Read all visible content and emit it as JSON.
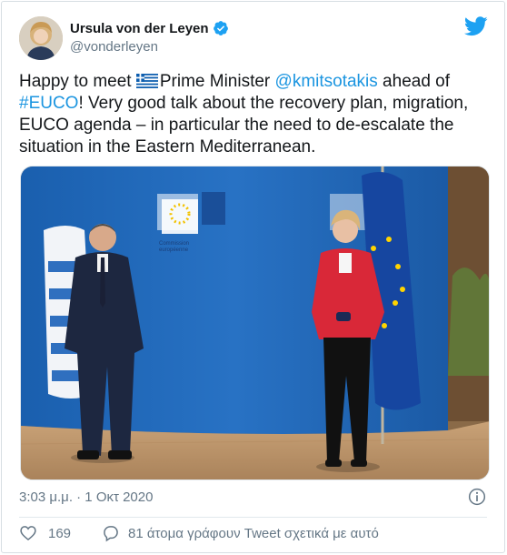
{
  "user": {
    "display_name": "Ursula von der Leyen",
    "handle": "@vonderleyen",
    "verified": true
  },
  "tweet": {
    "text_1": "Happy to meet ",
    "flag_icon": "greece-flag-icon",
    "text_2": "Prime Minister ",
    "mention": "@kmitsotakis",
    "text_3": " ahead of",
    "hashtag": "#EUCO",
    "text_4": "! Very good talk about the recovery plan, migration, EUCO agenda – in particular the need to de-escalate the situation in the Eastern Mediterranean."
  },
  "photo": {
    "sign_line1": "Commission",
    "sign_line2": "européenne"
  },
  "meta": {
    "timestamp": "3:03 μ.μ. · 1 Οκτ 2020"
  },
  "actions": {
    "like_count": "169",
    "reply_text": "81 άτομα γράφουν Tweet σχετικά με αυτό"
  },
  "colors": {
    "link": "#1b95e0",
    "twitter_blue": "#1da1f2",
    "muted": "#657786"
  }
}
